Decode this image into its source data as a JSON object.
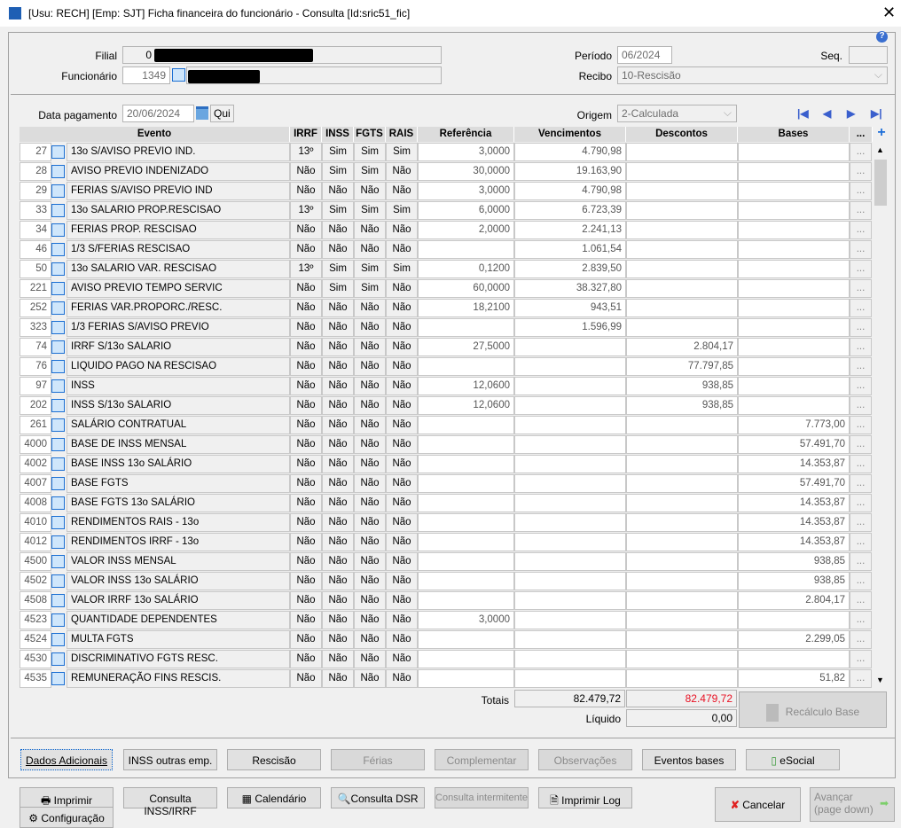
{
  "window": {
    "title": "[Usu: RECH] [Emp: SJT] Ficha financeira do funcionário - Consulta [Id:sric51_fic]"
  },
  "header": {
    "filial_label": "Filial",
    "filial_code": "0",
    "funcionario_label": "Funcionário",
    "funcionario_code": "1349",
    "periodo_label": "Período",
    "periodo": "06/2024",
    "seq_label": "Seq.",
    "seq": "",
    "recibo_label": "Recibo",
    "recibo": "10-Rescisão",
    "data_pag_label": "Data pagamento",
    "data_pag": "20/06/2024",
    "weekday": "Qui",
    "origem_label": "Origem",
    "origem": "2-Calculada"
  },
  "columns": [
    "Evento",
    "IRRF",
    "INSS",
    "FGTS",
    "RAIS",
    "Referência",
    "Vencimentos",
    "Descontos",
    "Bases",
    "..."
  ],
  "rows": [
    [
      "27",
      "13o S/AVISO PREVIO IND.",
      "13º",
      "Sim",
      "Sim",
      "Sim",
      "3,0000",
      "4.790,98",
      "",
      ""
    ],
    [
      "28",
      "AVISO PREVIO INDENIZADO",
      "Não",
      "Sim",
      "Sim",
      "Não",
      "30,0000",
      "19.163,90",
      "",
      ""
    ],
    [
      "29",
      "FERIAS S/AVISO PREVIO IND",
      "Não",
      "Não",
      "Não",
      "Não",
      "3,0000",
      "4.790,98",
      "",
      ""
    ],
    [
      "33",
      "13o SALARIO PROP.RESCISAO",
      "13º",
      "Sim",
      "Sim",
      "Sim",
      "6,0000",
      "6.723,39",
      "",
      ""
    ],
    [
      "34",
      "FERIAS PROP. RESCISAO",
      "Não",
      "Não",
      "Não",
      "Não",
      "2,0000",
      "2.241,13",
      "",
      ""
    ],
    [
      "46",
      "1/3 S/FERIAS RESCISAO",
      "Não",
      "Não",
      "Não",
      "Não",
      "",
      "1.061,54",
      "",
      ""
    ],
    [
      "50",
      "13o SALARIO VAR. RESCISAO",
      "13º",
      "Sim",
      "Sim",
      "Sim",
      "0,1200",
      "2.839,50",
      "",
      ""
    ],
    [
      "221",
      "AVISO PREVIO TEMPO SERVIC",
      "Não",
      "Sim",
      "Sim",
      "Não",
      "60,0000",
      "38.327,80",
      "",
      ""
    ],
    [
      "252",
      "FERIAS VAR.PROPORC./RESC.",
      "Não",
      "Não",
      "Não",
      "Não",
      "18,2100",
      "943,51",
      "",
      ""
    ],
    [
      "323",
      "1/3 FERIAS S/AVISO PREVIO",
      "Não",
      "Não",
      "Não",
      "Não",
      "",
      "1.596,99",
      "",
      ""
    ],
    [
      "74",
      "IRRF S/13o SALARIO",
      "Não",
      "Não",
      "Não",
      "Não",
      "27,5000",
      "",
      "2.804,17",
      ""
    ],
    [
      "76",
      "LIQUIDO PAGO NA RESCISAO",
      "Não",
      "Não",
      "Não",
      "Não",
      "",
      "",
      "77.797,85",
      ""
    ],
    [
      "97",
      "INSS",
      "Não",
      "Não",
      "Não",
      "Não",
      "12,0600",
      "",
      "938,85",
      ""
    ],
    [
      "202",
      "INSS S/13o SALARIO",
      "Não",
      "Não",
      "Não",
      "Não",
      "12,0600",
      "",
      "938,85",
      ""
    ],
    [
      "261",
      "SALÁRIO CONTRATUAL",
      "Não",
      "Não",
      "Não",
      "Não",
      "",
      "",
      "",
      "7.773,00"
    ],
    [
      "4000",
      "BASE DE INSS MENSAL",
      "Não",
      "Não",
      "Não",
      "Não",
      "",
      "",
      "",
      "57.491,70"
    ],
    [
      "4002",
      "BASE INSS 13o SALÁRIO",
      "Não",
      "Não",
      "Não",
      "Não",
      "",
      "",
      "",
      "14.353,87"
    ],
    [
      "4007",
      "BASE FGTS",
      "Não",
      "Não",
      "Não",
      "Não",
      "",
      "",
      "",
      "57.491,70"
    ],
    [
      "4008",
      "BASE FGTS 13o SALÁRIO",
      "Não",
      "Não",
      "Não",
      "Não",
      "",
      "",
      "",
      "14.353,87"
    ],
    [
      "4010",
      "RENDIMENTOS RAIS - 13o",
      "Não",
      "Não",
      "Não",
      "Não",
      "",
      "",
      "",
      "14.353,87"
    ],
    [
      "4012",
      "RENDIMENTOS IRRF - 13o",
      "Não",
      "Não",
      "Não",
      "Não",
      "",
      "",
      "",
      "14.353,87"
    ],
    [
      "4500",
      "VALOR INSS MENSAL",
      "Não",
      "Não",
      "Não",
      "Não",
      "",
      "",
      "",
      "938,85"
    ],
    [
      "4502",
      "VALOR INSS 13o SALÁRIO",
      "Não",
      "Não",
      "Não",
      "Não",
      "",
      "",
      "",
      "938,85"
    ],
    [
      "4508",
      "VALOR IRRF 13o SALÁRIO",
      "Não",
      "Não",
      "Não",
      "Não",
      "",
      "",
      "",
      "2.804,17"
    ],
    [
      "4523",
      "QUANTIDADE DEPENDENTES",
      "Não",
      "Não",
      "Não",
      "Não",
      "3,0000",
      "",
      "",
      ""
    ],
    [
      "4524",
      "MULTA FGTS",
      "Não",
      "Não",
      "Não",
      "Não",
      "",
      "",
      "",
      "2.299,05"
    ],
    [
      "4530",
      "DISCRIMINATIVO FGTS RESC.",
      "Não",
      "Não",
      "Não",
      "Não",
      "",
      "",
      "",
      ""
    ],
    [
      "4535",
      "REMUNERAÇÃO FINS RESCIS.",
      "Não",
      "Não",
      "Não",
      "Não",
      "",
      "",
      "",
      "51,82"
    ]
  ],
  "totals": {
    "label": "Totais",
    "vencimentos": "82.479,72",
    "descontos": "82.479,72",
    "liquido_label": "Líquido",
    "liquido": "0,00",
    "recalc": "Recálculo Base",
    "descontos_color": "#e81123"
  },
  "tabs": [
    "Dados Adicionais",
    "INSS outras emp.",
    "Rescisão",
    "Férias",
    "Complementar",
    "Observações",
    "Eventos bases",
    "eSocial"
  ],
  "footer": {
    "imprimir": "Imprimir",
    "consulta_inss": "Consulta INSS/IRRF",
    "calendario": "Calendário",
    "consulta_dsr": "Consulta DSR",
    "consulta_interm": "Consulta intermitente",
    "imprimir_log": "Imprimir Log",
    "configuracao": "Configuração",
    "cancelar": "Cancelar",
    "avancar": "Avançar",
    "avancar_sub": "(page down)"
  }
}
